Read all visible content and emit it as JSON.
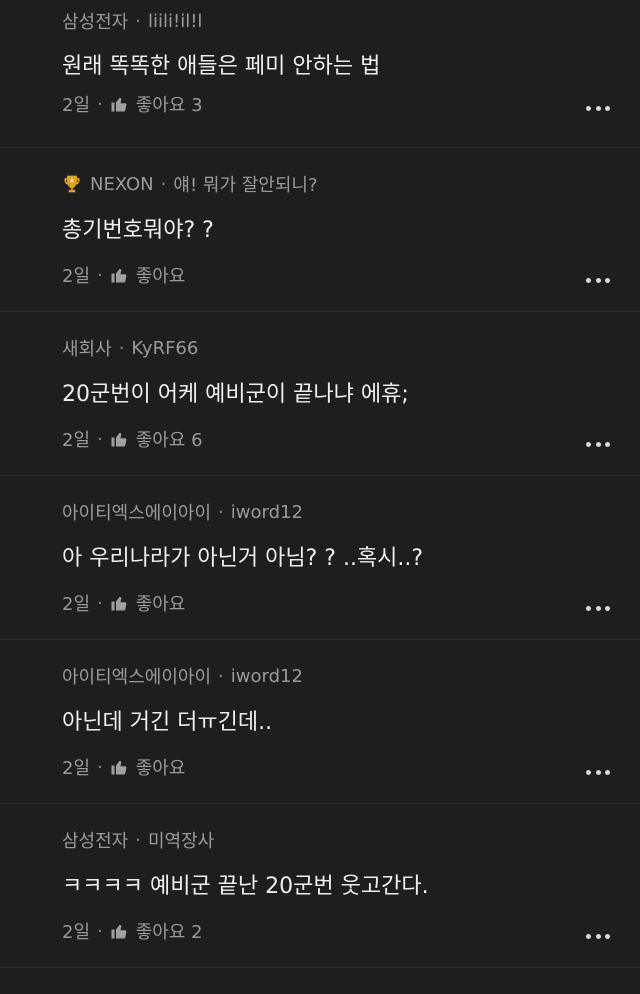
{
  "comments": [
    {
      "company": "삼성전자",
      "nickname": "liili!il!l",
      "has_trophy": false,
      "text": "원래 똑똑한 애들은 페미 안하는 법",
      "time": "2일",
      "like_label": "좋아요 3",
      "more_icon": "more-horizontal-icon"
    },
    {
      "company": "NEXON",
      "nickname": "얘! 뭐가 잘안되니?",
      "has_trophy": true,
      "text": "총기번호뭐야? ?",
      "time": "2일",
      "like_label": "좋아요",
      "more_icon": "more-horizontal-icon"
    },
    {
      "company": "새회사",
      "nickname": "KyRF66",
      "has_trophy": false,
      "text": "20군번이 어케 예비군이 끝나냐 에휴;",
      "time": "2일",
      "like_label": "좋아요 6",
      "more_icon": "more-horizontal-icon"
    },
    {
      "company": "아이티엑스에이아이",
      "nickname": "iword12",
      "has_trophy": false,
      "text": "아 우리나라가 아닌거 아님? ? ..혹시..?",
      "time": "2일",
      "like_label": "좋아요",
      "more_icon": "more-horizontal-icon"
    },
    {
      "company": "아이티엑스에이아이",
      "nickname": "iword12",
      "has_trophy": false,
      "text": "아닌데 거긴 더ㅠ긴데..",
      "time": "2일",
      "like_label": "좋아요",
      "more_icon": "more-horizontal-icon"
    },
    {
      "company": "삼성전자",
      "nickname": "미역장사",
      "has_trophy": false,
      "text": "ㅋㅋㅋㅋ 예비군 끝난 20군번 웃고간다.",
      "time": "2일",
      "like_label": "좋아요 2",
      "more_icon": "more-horizontal-icon"
    }
  ],
  "colors": {
    "background": "#1e1e1e",
    "meta_text": "#9a9a9a",
    "body_text": "#efefef",
    "divider": "#2e2e2e",
    "trophy": "#e0a020"
  }
}
